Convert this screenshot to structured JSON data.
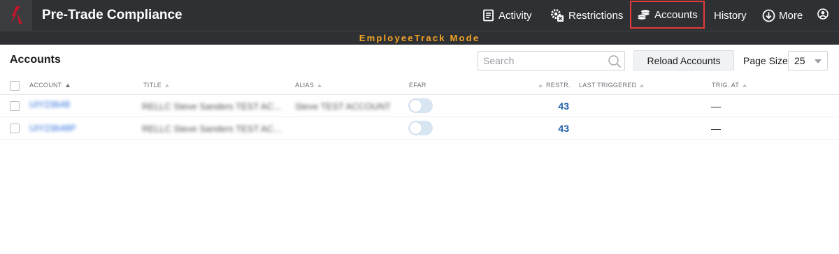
{
  "app": {
    "title": "Pre-Trade Compliance",
    "logo_icon": "brand-logo-icon",
    "accent_color": "#c0182b"
  },
  "nav": {
    "activity": "Activity",
    "restrictions": "Restrictions",
    "accounts": "Accounts",
    "history": "History",
    "more": "More",
    "active_item": "accounts"
  },
  "mode_banner": "EmployeeTrack Mode",
  "toolbar": {
    "section_title": "Accounts",
    "search_placeholder": "Search",
    "search_value": "",
    "reload_label": "Reload Accounts",
    "page_size_label": "Page Size",
    "page_size_value": "25"
  },
  "table": {
    "columns": {
      "account": "ACCOUNT",
      "title": "TITLE",
      "alias": "ALIAS",
      "efar": "EFAR",
      "restr": "RESTR.",
      "last_triggered": "LAST TRIGGERED",
      "trig_at": "TRIG. AT"
    },
    "rows": [
      {
        "account": "UIY23648",
        "title": "RELLC Steve Sanders TEST AC...",
        "alias": "Steve TEST ACCOUNT",
        "efar": false,
        "restr": "43",
        "last_triggered": "",
        "trig_at": "—"
      },
      {
        "account": "UIY23648P",
        "title": "RELLC Steve Sanders TEST AC...",
        "alias": "",
        "efar": false,
        "restr": "43",
        "last_triggered": "",
        "trig_at": "—"
      }
    ]
  }
}
